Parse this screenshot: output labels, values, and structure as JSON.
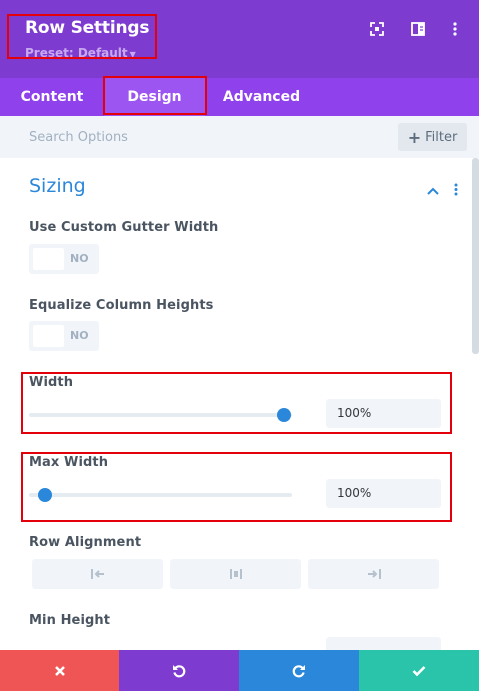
{
  "header": {
    "title": "Row Settings",
    "preset": "Preset: Default",
    "icons": [
      "fullscreen-icon",
      "split-view-icon",
      "more-icon"
    ]
  },
  "tabs": [
    {
      "label": "Content",
      "active": false
    },
    {
      "label": "Design",
      "active": true
    },
    {
      "label": "Advanced",
      "active": false
    }
  ],
  "search": {
    "placeholder": "Search Options",
    "filter_label": "Filter"
  },
  "section": {
    "title": "Sizing"
  },
  "fields": {
    "gutter": {
      "label": "Use Custom Gutter Width",
      "state": "NO"
    },
    "equalize": {
      "label": "Equalize Column Heights",
      "state": "NO"
    },
    "width": {
      "label": "Width",
      "value": "100%",
      "slider_fraction": 0.97
    },
    "max_width": {
      "label": "Max Width",
      "value": "100%",
      "slider_fraction": 0.06
    },
    "row_alignment": {
      "label": "Row Alignment",
      "options": [
        "align-left-icon",
        "align-center-icon",
        "align-right-icon"
      ]
    },
    "min_height": {
      "label": "Min Height"
    }
  },
  "footer": {
    "buttons": [
      {
        "name": "discard",
        "icon": "close-icon",
        "color": "#ef5555"
      },
      {
        "name": "undo",
        "icon": "undo-icon",
        "color": "#7e3bd0"
      },
      {
        "name": "redo",
        "icon": "redo-icon",
        "color": "#2b87da"
      },
      {
        "name": "save",
        "icon": "check-icon",
        "color": "#29c4a9"
      }
    ]
  },
  "colors": {
    "header_bg": "#7e3bd0",
    "tabs_bg": "#8f42ec",
    "accent": "#2b87da",
    "highlight": "#e3000b"
  }
}
